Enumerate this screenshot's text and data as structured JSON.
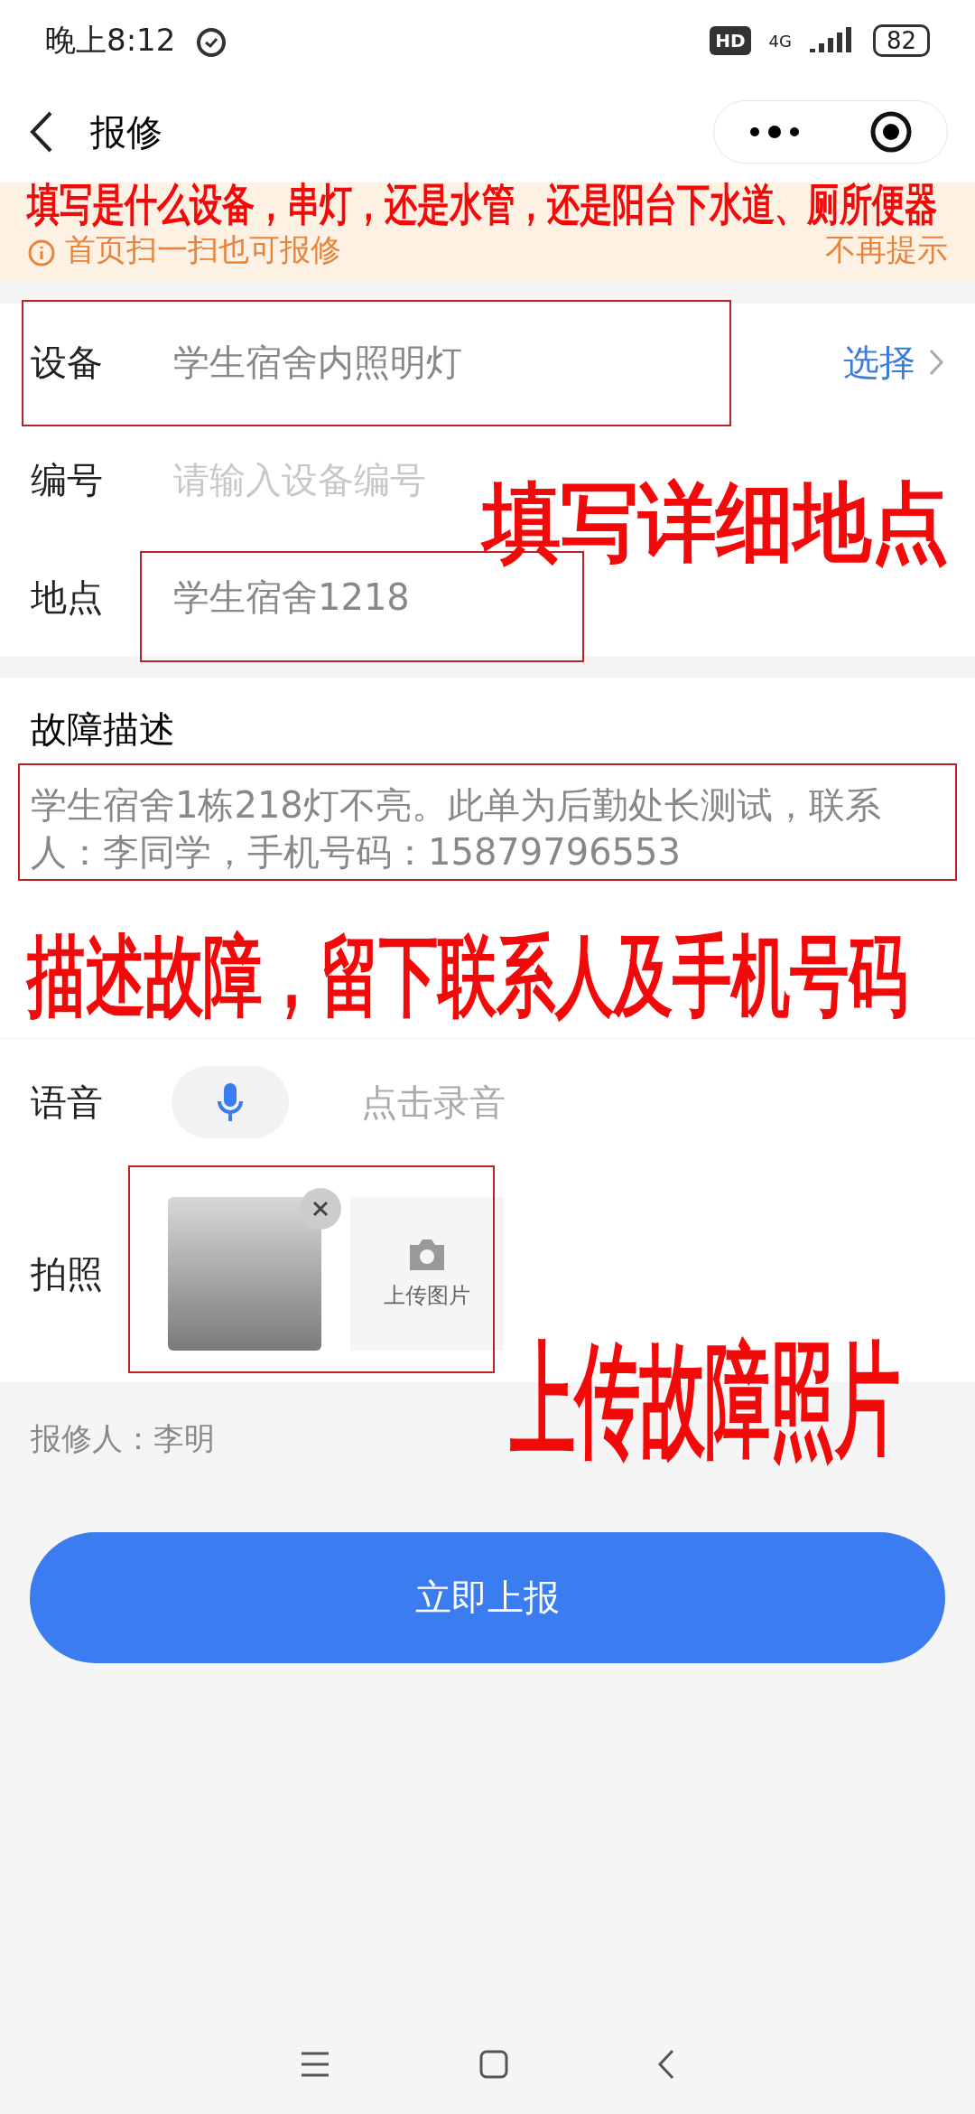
{
  "status_bar": {
    "time": "晚上8:12",
    "hd": "HD",
    "network": "4G",
    "battery": "82"
  },
  "nav": {
    "title": "报修"
  },
  "notice": {
    "text": "首页扫一扫也可报修",
    "dismiss": "不再提示"
  },
  "fields": [
    {
      "kind": "select",
      "label": "设备",
      "value": "学生宿舍内照明灯",
      "action": "选择"
    },
    {
      "kind": "input",
      "label": "编号",
      "placeholder": "请输入设备编号"
    },
    {
      "kind": "input",
      "label": "地点",
      "value": "学生宿舍1218"
    }
  ],
  "description": {
    "label": "故障描述",
    "value": "学生宿舍1栋218灯不亮。此单为后勤处长测试，联系人：李同学，手机号码：15879796553"
  },
  "voice": {
    "label": "语音",
    "hint": "点击录音"
  },
  "photo": {
    "label": "拍照",
    "upload": "上传图片"
  },
  "reporter": "报修人：李明",
  "submit": "立即上报",
  "annotations": [
    "填写是什么设备，串灯，还是水管，还是阳台下水道、厕所便器",
    "填写详细地点",
    "描述故障，留下联系人及手机号码",
    "上传故障照片"
  ]
}
